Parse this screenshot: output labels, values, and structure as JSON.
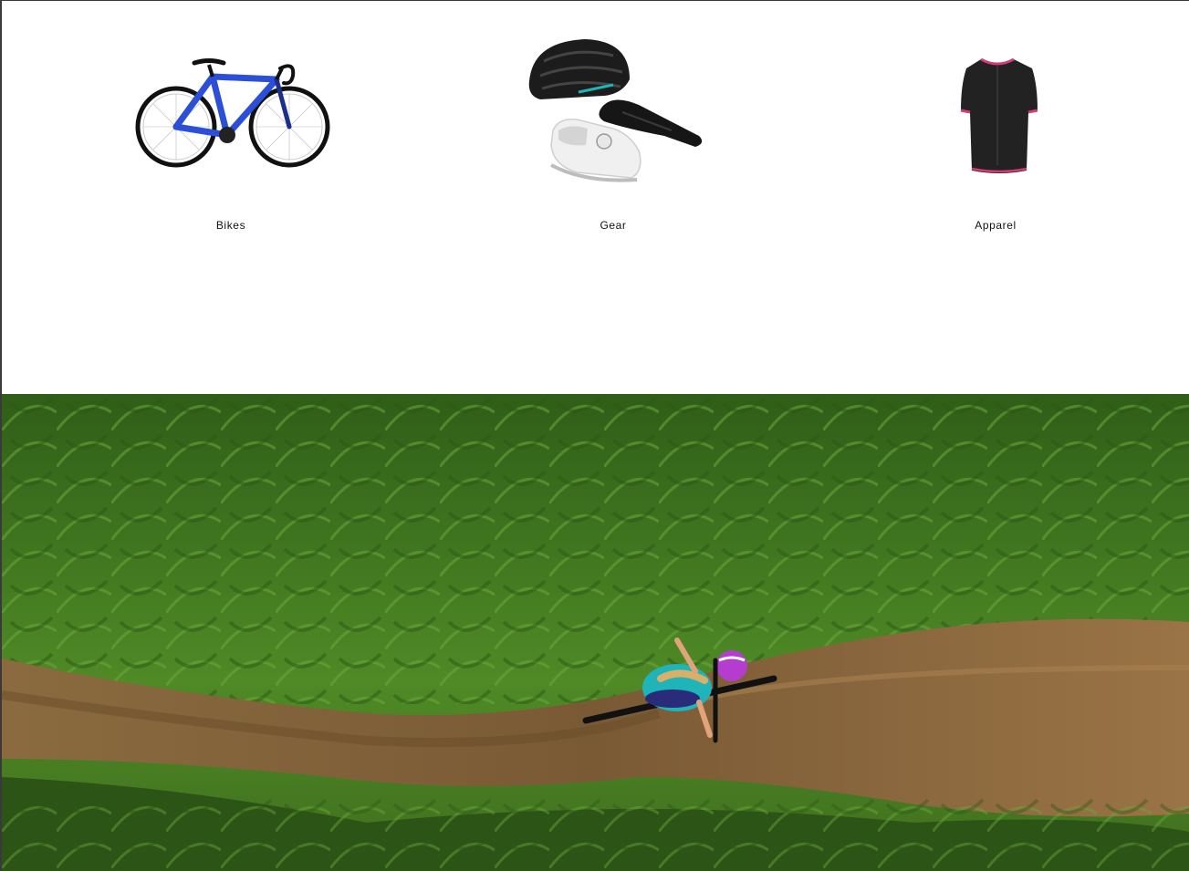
{
  "categories": [
    {
      "label": "Bikes",
      "icon": "road-bike-image"
    },
    {
      "label": "Gear",
      "icon": "helmet-saddle-shoe-image"
    },
    {
      "label": "Apparel",
      "icon": "cycling-jersey-image"
    }
  ],
  "hero": {
    "image": "aerial-mountain-biker-on-forest-trail-photo"
  },
  "colors": {
    "bike_frame": "#2b4fd6",
    "jersey": "#222222",
    "jersey_trim": "#d23a7a",
    "foliage": "#3f7d22",
    "trail": "#8a6a42",
    "rider_jersey": "#1fb5b8",
    "rider_helmet": "#b43ccf"
  }
}
